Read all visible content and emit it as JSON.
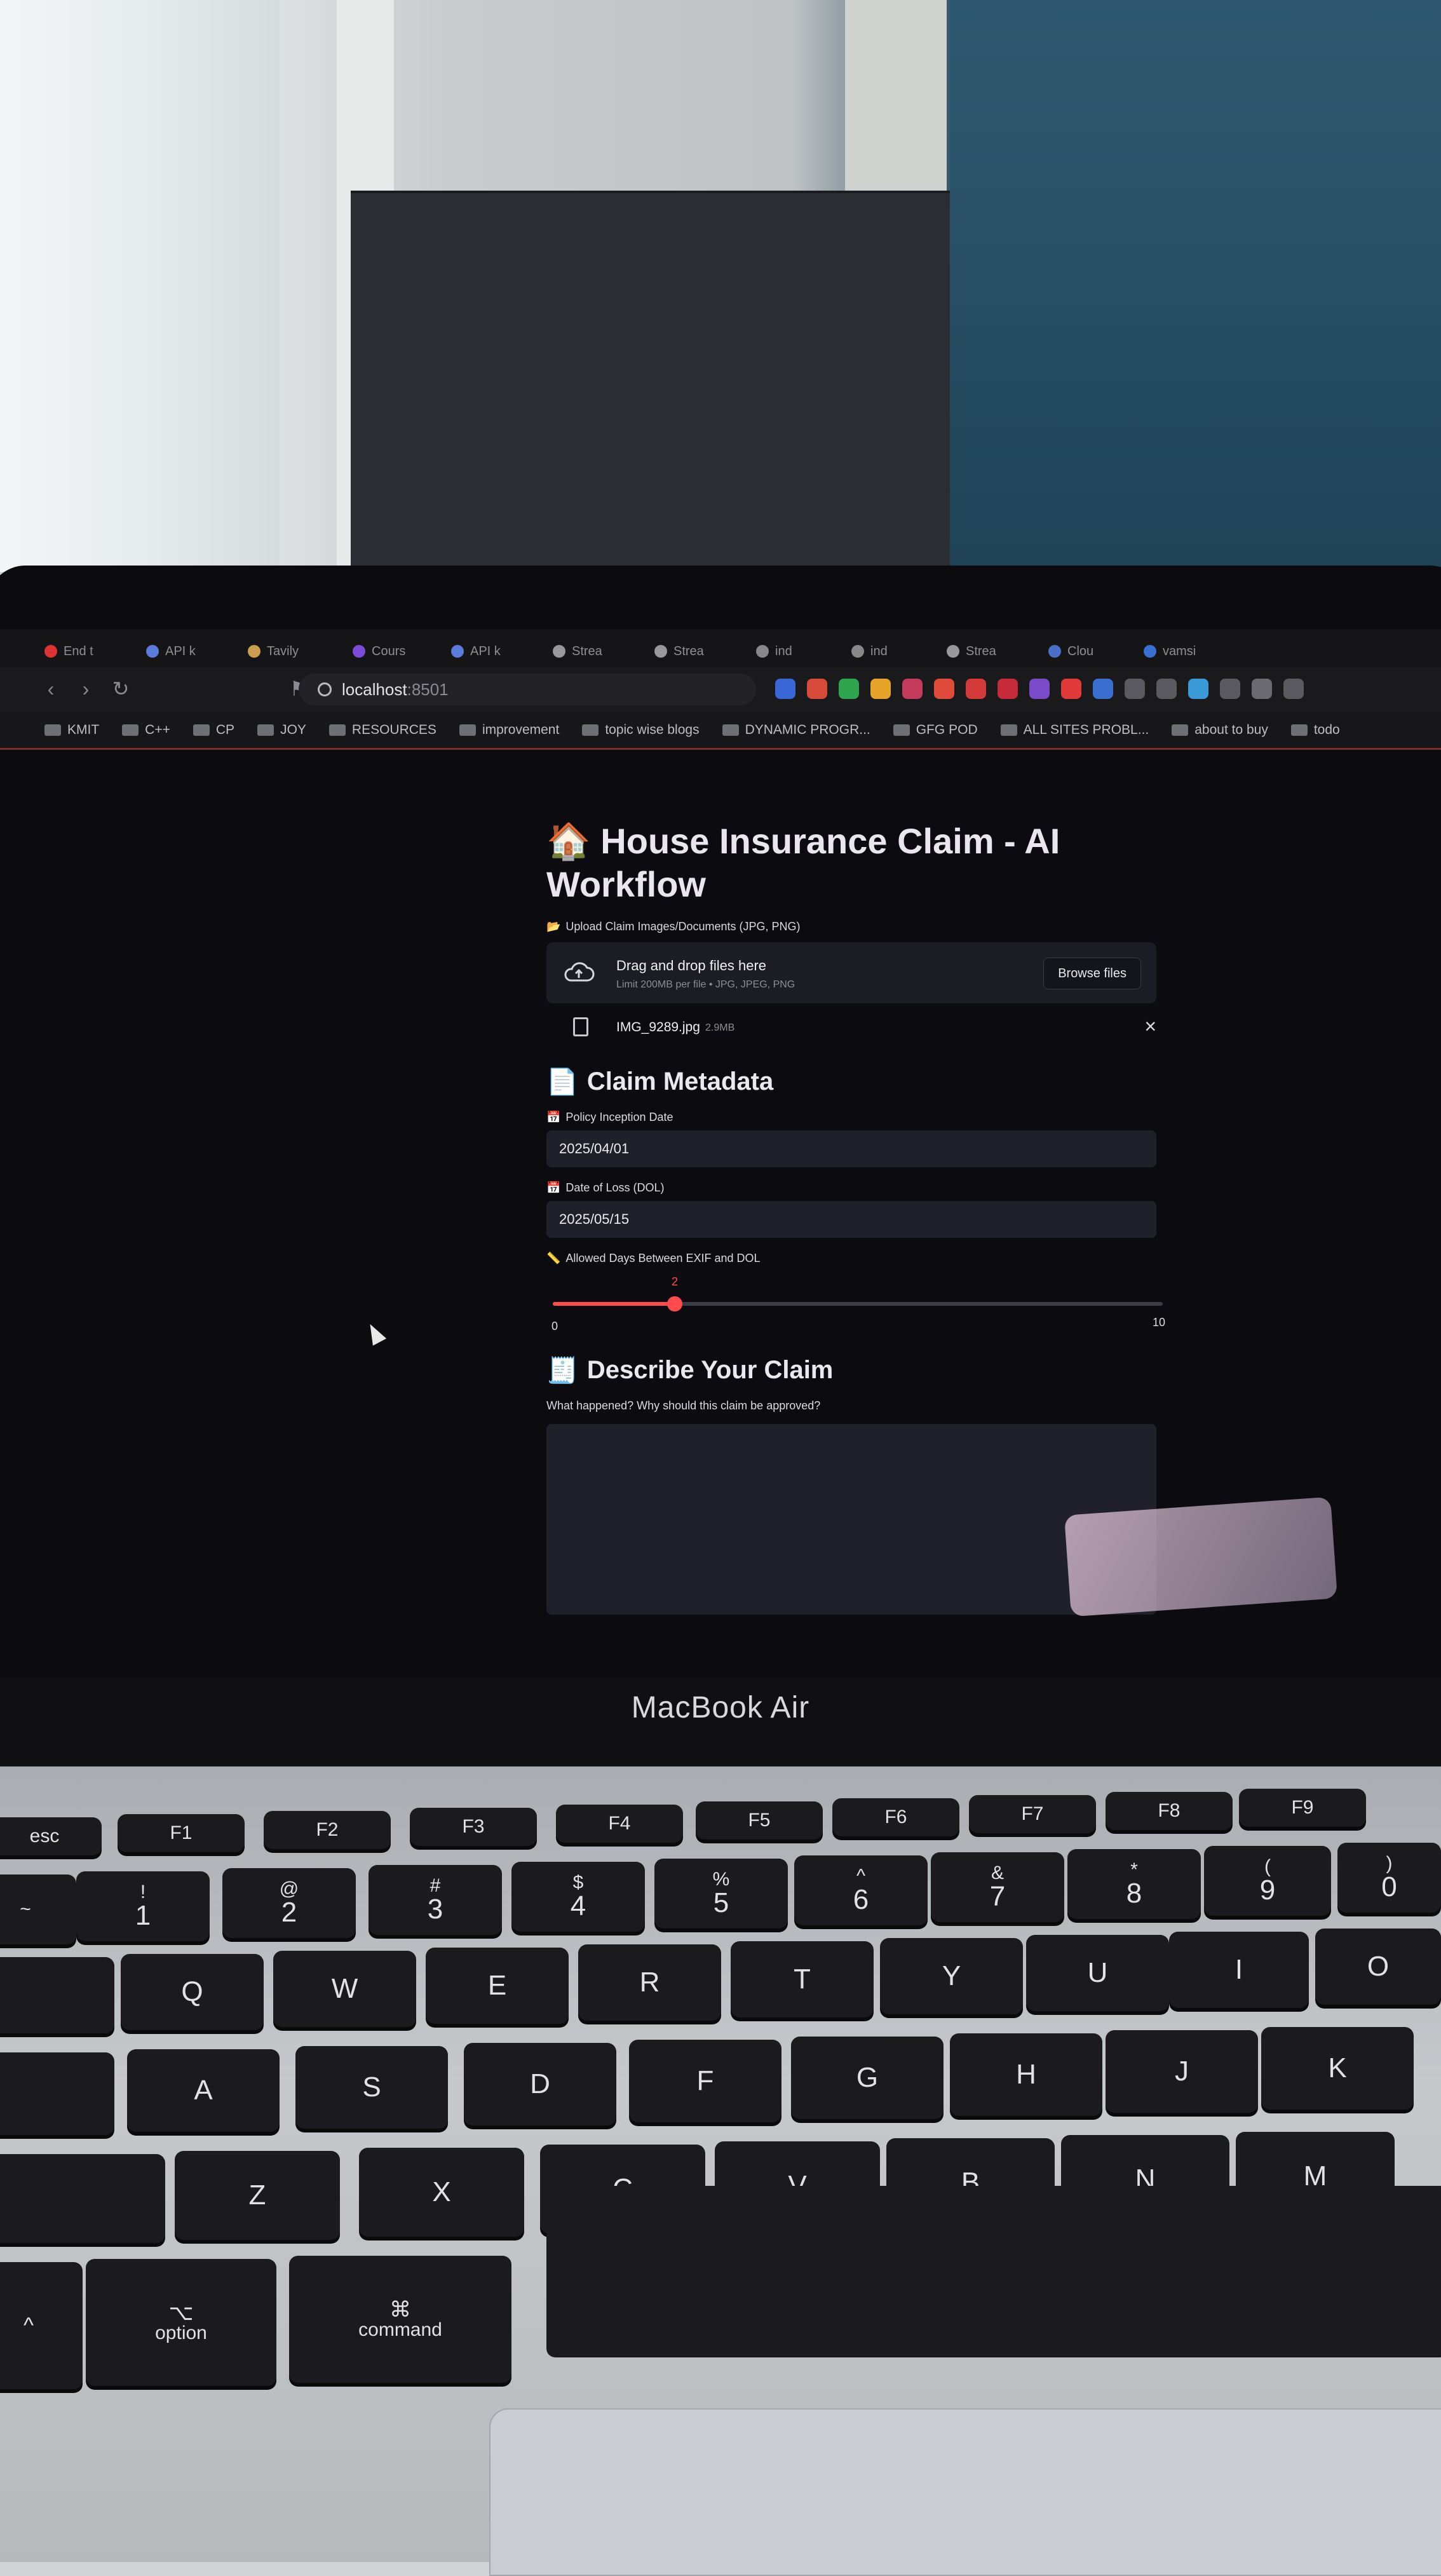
{
  "browser": {
    "tabs": [
      "End t",
      "API k",
      "Tavily",
      "Cours",
      "API k",
      "Strea",
      "Strea",
      "ind",
      "ind",
      "Strea",
      "Clou",
      "vamsi"
    ],
    "url_host": "localhost",
    "url_port": ":8501",
    "bookmarks": [
      "KMIT",
      "C++",
      "CP",
      "JOY",
      "RESOURCES",
      "improvement",
      "topic wise blogs",
      "DYNAMIC PROGR...",
      "GFG POD",
      "ALL SITES PROBL...",
      "about to buy",
      "todo"
    ]
  },
  "app": {
    "title": "House Insurance Claim - AI Workflow",
    "uploader_label": "Upload Claim Images/Documents (JPG, PNG)",
    "drop_main": "Drag and drop files here",
    "drop_sub": "Limit 200MB per file • JPG, JPEG, PNG",
    "browse_label": "Browse files",
    "uploaded_file": {
      "name": "IMG_9289.jpg",
      "size": "2.9MB",
      "remove": "×"
    },
    "metadata_heading": "Claim Metadata",
    "policy_label": "Policy Inception Date",
    "policy_value": "2025/04/01",
    "dol_label": "Date of Loss (DOL)",
    "dol_value": "2025/05/15",
    "slider_label": "Allowed Days Between EXIF and DOL",
    "slider": {
      "value": 2,
      "min": 0,
      "max": 10,
      "value_text": "2",
      "min_text": "0",
      "max_text": "10"
    },
    "describe_heading": "Describe Your Claim",
    "describe_label": "What happened? Why should this claim be approved?"
  },
  "laptop": {
    "bezel_label": "MacBook Air"
  },
  "keyboard": {
    "fn_row": [
      "esc",
      "F1",
      "F2",
      "F3",
      "F4",
      "F5",
      "F6",
      "F7",
      "F8",
      "F9"
    ],
    "num_row": [
      [
        "~",
        ""
      ],
      [
        "!",
        "1"
      ],
      [
        "@",
        "2"
      ],
      [
        "#",
        "3"
      ],
      [
        "$",
        "4"
      ],
      [
        "%",
        "5"
      ],
      [
        "^",
        "6"
      ],
      [
        "&",
        "7"
      ],
      [
        "*",
        "8"
      ],
      [
        "(",
        "9"
      ],
      [
        ")",
        "0"
      ]
    ],
    "row_q": [
      "Q",
      "W",
      "E",
      "R",
      "T",
      "Y",
      "U",
      "I",
      "O"
    ],
    "row_a": [
      "A",
      "S",
      "D",
      "F",
      "G",
      "H",
      "J",
      "K"
    ],
    "row_z": [
      "Z",
      "X",
      "C",
      "V",
      "B",
      "N",
      "M"
    ],
    "mods": {
      "option": "option",
      "command": "command"
    }
  },
  "colors": {
    "accent": "#ff4b4b",
    "app_bg": "#0c0c10",
    "input_bg": "#1f2029"
  }
}
